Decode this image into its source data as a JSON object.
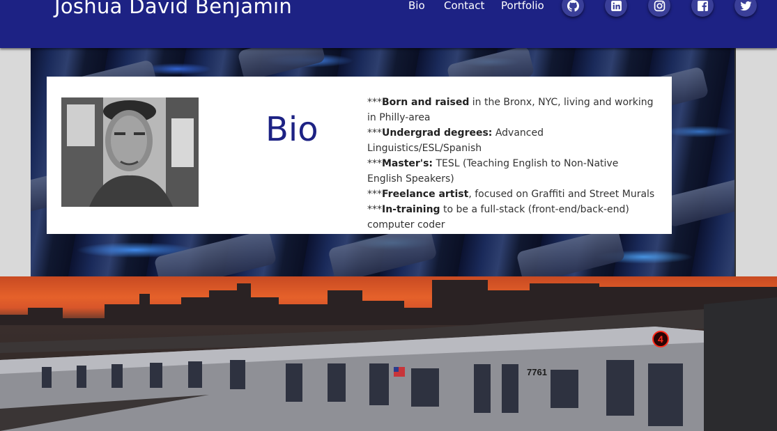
{
  "header": {
    "brand": "Joshua David Benjamin",
    "nav": [
      "Bio",
      "Contact",
      "Portfolio"
    ],
    "social": [
      "github-icon",
      "linkedin-icon",
      "instagram-icon",
      "facebook-icon",
      "twitter-icon"
    ]
  },
  "bio": {
    "title": "Bio",
    "lines": [
      {
        "prefix": "***",
        "bold": "Born and raised",
        "rest": " in the Bronx, NYC, living and working in Philly-area"
      },
      {
        "prefix": "***",
        "bold": "Undergrad degrees:",
        "rest": " Advanced Linguistics/ESL/Spanish"
      },
      {
        "prefix": "***",
        "bold": "Master's:",
        "rest": " TESL (Teaching English to Non-Native English Speakers)"
      },
      {
        "prefix": "***",
        "bold": "Freelance artist",
        "rest": ", focused on Graffiti and Street Murals"
      },
      {
        "prefix": "***",
        "bold": "In-training",
        "rest": " to be a full-stack (front-end/back-end) computer coder"
      }
    ]
  },
  "subway": {
    "car_number": "7761",
    "route": "4"
  },
  "colors": {
    "header_bg": "#1d2284",
    "accent": "#1d2284",
    "route_sign": "#ff2a1a"
  }
}
